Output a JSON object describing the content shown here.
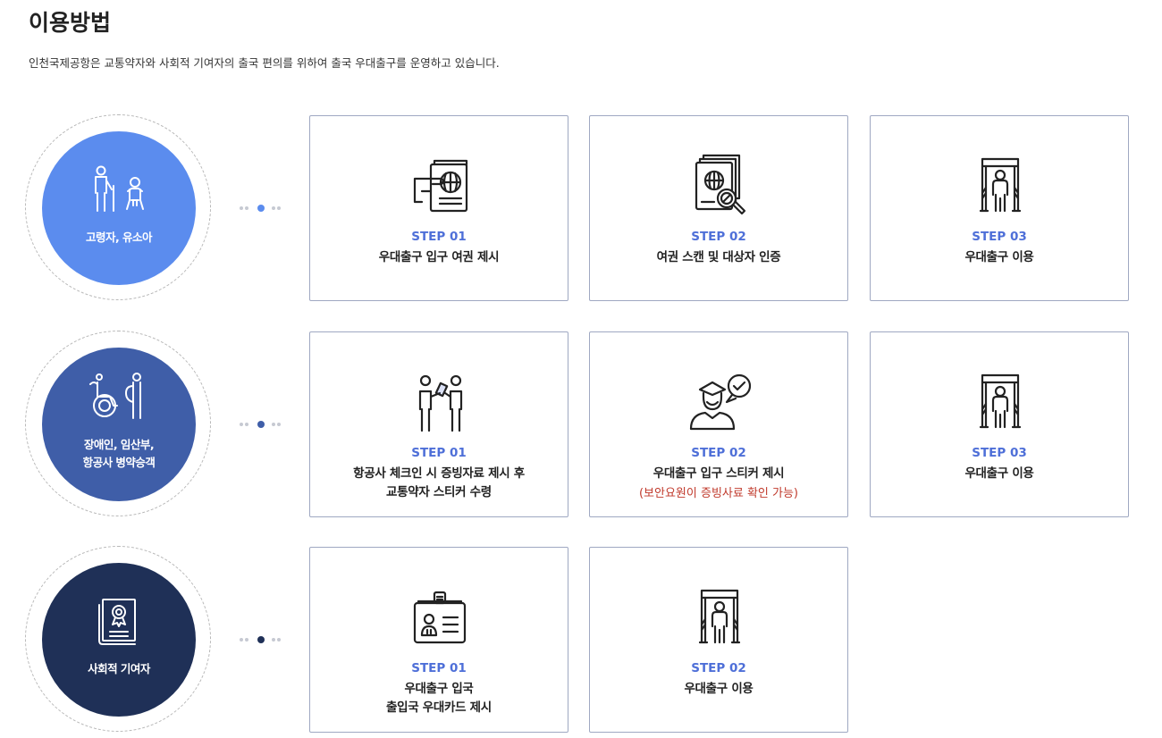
{
  "page": {
    "title": "이용방법",
    "description": "인천국제공항은 교통약자와 사회적 기여자의 출국 편의를 위하여 출국 우대출구를 운영하고 있습니다."
  },
  "colors": {
    "group1": "#5b8cee",
    "group2": "#3f5ea8",
    "group3": "#1f3057",
    "step": "#4e6fd8",
    "note": "#c0392b",
    "border": "#9fa8c2"
  },
  "groups": [
    {
      "label": "고령자, 유소아",
      "icon": "elderly-child-icon",
      "steps": [
        {
          "step": "STEP 01",
          "label": "우대출구 입구 여권 제시",
          "icon": "passport-hand-icon"
        },
        {
          "step": "STEP 02",
          "label": "여권 스캔 및 대상자 인증",
          "icon": "passport-scan-icon"
        },
        {
          "step": "STEP 03",
          "label": "우대출구 이용",
          "icon": "security-gate-icon"
        }
      ]
    },
    {
      "label": "장애인, 임산부,\n항공사 병약승객",
      "icon": "wheelchair-pregnant-icon",
      "steps": [
        {
          "step": "STEP 01",
          "label": "항공사 체크인 시 증빙자료 제시 후\n교통약자 스티커 수령",
          "icon": "staff-handover-icon"
        },
        {
          "step": "STEP 02",
          "label": "우대출구 입구 스티커 제시",
          "note": "(보안요원이 증빙사료 확인 가능)",
          "icon": "security-officer-icon"
        },
        {
          "step": "STEP 03",
          "label": "우대출구 이용",
          "icon": "security-gate-icon"
        }
      ]
    },
    {
      "label": "사회적 기여자",
      "icon": "certificate-icon",
      "steps": [
        {
          "step": "STEP 01",
          "label": "우대출구 입국\n출입국 우대카드 제시",
          "icon": "id-card-icon"
        },
        {
          "step": "STEP 02",
          "label": "우대출구 이용",
          "icon": "security-gate-icon"
        }
      ]
    }
  ]
}
